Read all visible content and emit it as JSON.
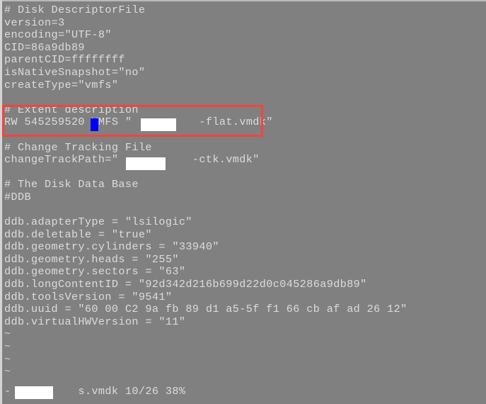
{
  "terminal": {
    "background_color": "#808080",
    "text_color": "#dcdcdc",
    "cursor_color": "#0000ff",
    "highlight_color": "#f4443c",
    "redaction_color": "#ffffff",
    "lines": [
      "# Disk DescriptorFile",
      "version=3",
      "encoding=\"UTF-8\"",
      "CID=86a9db89",
      "parentCID=ffffffff",
      "isNativeSnapshot=\"no\"",
      "createType=\"vmfs\"",
      "",
      "# Extent description",
      "RW 545259520 VMFS \"",
      "",
      "# Change Tracking File",
      "changeTrackPath=\"",
      "",
      "# The Disk Data Base",
      "#DDB",
      "",
      "ddb.adapterType = \"lsilogic\"",
      "ddb.deletable = \"true\"",
      "ddb.geometry.cylinders = \"33940\"",
      "ddb.geometry.heads = \"255\"",
      "ddb.geometry.sectors = \"63\"",
      "ddb.longContentID = \"92d342d216b699d22d0c045286a9db89\"",
      "ddb.toolsVersion = \"9541\"",
      "ddb.uuid = \"60 00 C2 9a fb 89 d1 a5-5f f1 66 cb af ad 26 12\"",
      "ddb.virtualHWVersion = \"11\""
    ],
    "extent_line": {
      "prefix": "RW 545259520",
      "cursor_char": " ",
      "middle": "VMFS \"",
      "redacted": "",
      "suffix": "-flat.vmdk\""
    },
    "change_track_line": {
      "prefix": "changeTrackPath=\"",
      "redacted": "",
      "suffix": "-ctk.vmdk\""
    },
    "empty_markers": [
      "~",
      "~",
      "~",
      "~"
    ],
    "empty_marker_symbol": "~"
  },
  "status": {
    "dash": "-",
    "redacted": "",
    "filename_suffix": "s.vmdk",
    "position": "10/26",
    "percent": "38%",
    "full_text": "- s.vmdk 10/26 38%"
  }
}
